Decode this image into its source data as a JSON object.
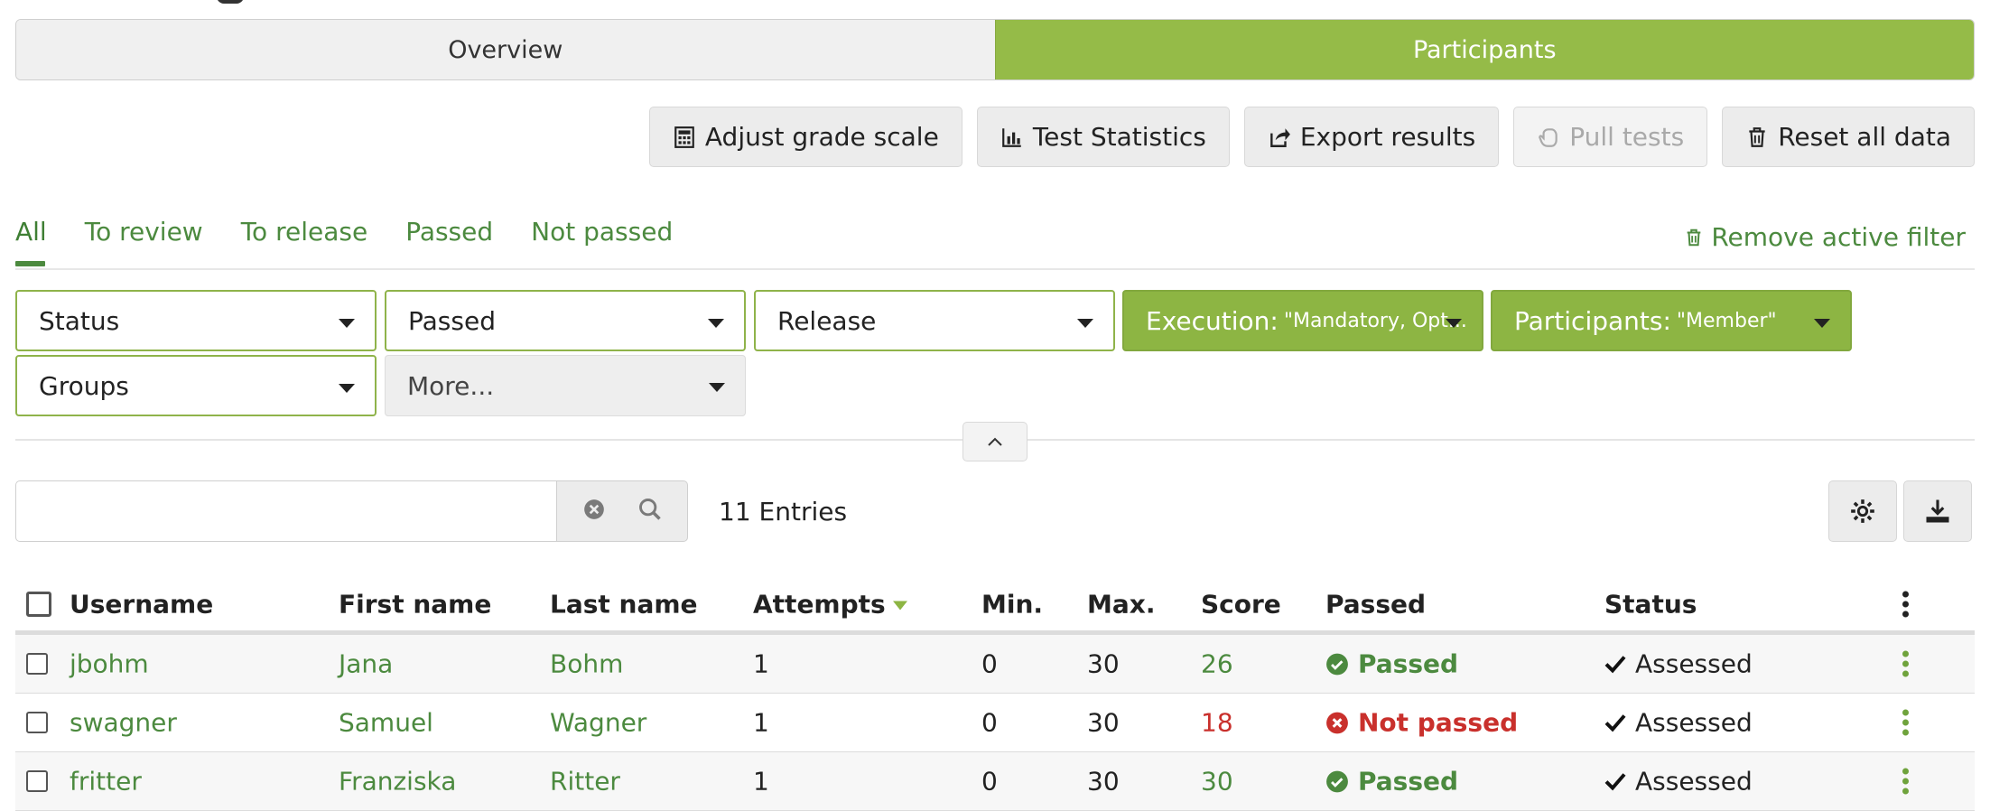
{
  "tabs": {
    "overview": "Overview",
    "participants": "Participants"
  },
  "toolbar": {
    "adjust_grade_scale": "Adjust grade scale",
    "test_statistics": "Test Statistics",
    "export_results": "Export results",
    "pull_tests": "Pull tests",
    "reset_all_data": "Reset all data"
  },
  "filter_tabs": {
    "all": "All",
    "to_review": "To review",
    "to_release": "To release",
    "passed": "Passed",
    "not_passed": "Not passed"
  },
  "remove_filter": "Remove active filter",
  "filters": {
    "status": "Status",
    "passed": "Passed",
    "release": "Release",
    "execution_label": "Execution:",
    "execution_value": "\"Mandatory, Opt...",
    "participants_label": "Participants:",
    "participants_value": "\"Member\"",
    "groups": "Groups",
    "more": "More..."
  },
  "search": {
    "value": "",
    "placeholder": ""
  },
  "entries": "11 Entries",
  "table": {
    "headers": {
      "username": "Username",
      "first_name": "First name",
      "last_name": "Last name",
      "attempts": "Attempts",
      "min": "Min.",
      "max": "Max.",
      "score": "Score",
      "passed": "Passed",
      "status": "Status"
    },
    "rows": [
      {
        "username": "jbohm",
        "first_name": "Jana",
        "last_name": "Bohm",
        "attempts": "1",
        "min": "0",
        "max": "30",
        "score": "26",
        "passed": "Passed",
        "status": "Assessed"
      },
      {
        "username": "swagner",
        "first_name": "Samuel",
        "last_name": "Wagner",
        "attempts": "1",
        "min": "0",
        "max": "30",
        "score": "18",
        "passed": "Not passed",
        "status": "Assessed"
      },
      {
        "username": "fritter",
        "first_name": "Franziska",
        "last_name": "Ritter",
        "attempts": "1",
        "min": "0",
        "max": "30",
        "score": "30",
        "passed": "Passed",
        "status": "Assessed"
      }
    ]
  },
  "colors": {
    "accent_green": "#95bb48",
    "link_green": "#4c8a3f",
    "fail_red": "#c9302c"
  },
  "icons": {
    "adjust_grade_scale": "calculator-icon",
    "test_statistics": "bar-chart-icon",
    "export_results": "share-icon",
    "pull_tests": "hand-icon",
    "reset_all_data": "trash-icon",
    "remove_filter": "trash-icon",
    "clear_search": "clear-icon",
    "search": "search-icon",
    "settings": "gear-icon",
    "download": "download-icon"
  }
}
